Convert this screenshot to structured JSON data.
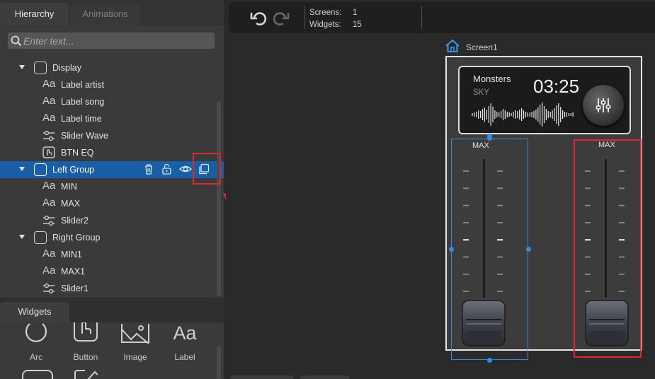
{
  "tabs": [
    {
      "label": "Hierarchy",
      "active": true
    },
    {
      "label": "Animations",
      "active": false
    }
  ],
  "search": {
    "placeholder": "Enter text..."
  },
  "tree": [
    {
      "label": "Display",
      "type": "group"
    },
    {
      "label": "Label artist",
      "type": "label"
    },
    {
      "label": "Label song",
      "type": "label"
    },
    {
      "label": "Label time",
      "type": "label"
    },
    {
      "label": "Slider Wave",
      "type": "slider"
    },
    {
      "label": "BTN EQ",
      "type": "button"
    },
    {
      "label": "Left Group",
      "type": "group",
      "selected": true
    },
    {
      "label": "MIN",
      "type": "label"
    },
    {
      "label": "MAX",
      "type": "label"
    },
    {
      "label": "Slider2",
      "type": "slider"
    },
    {
      "label": "Right Group",
      "type": "group"
    },
    {
      "label": "MIN1",
      "type": "label"
    },
    {
      "label": "MAX1",
      "type": "label"
    },
    {
      "label": "Slider1",
      "type": "slider"
    }
  ],
  "row_actions": [
    "trash-icon",
    "lock-icon",
    "eye-icon",
    "duplicate-icon"
  ],
  "widgets_panel": {
    "title": "Widgets",
    "items": [
      {
        "label": "Arc",
        "icon": "arc-icon"
      },
      {
        "label": "Button",
        "icon": "button-icon"
      },
      {
        "label": "Image",
        "icon": "image-icon"
      },
      {
        "label": "Label",
        "icon": "label-icon"
      }
    ]
  },
  "toolbar": {
    "screens_label": "Screens:",
    "screens_value": "1",
    "widgets_label": "Widgets:",
    "widgets_value": "15"
  },
  "canvas": {
    "screen_name": "Screen1",
    "artist": "Monsters",
    "song": "SKY",
    "time": "03:25",
    "left_max": "MAX",
    "right_max": "MAX",
    "left_slider_value": 0,
    "right_slider_value": 0
  },
  "colors": {
    "selection": "#1a5ea5",
    "widget_outline": "#2f8de4",
    "highlight": "#e1262d"
  }
}
